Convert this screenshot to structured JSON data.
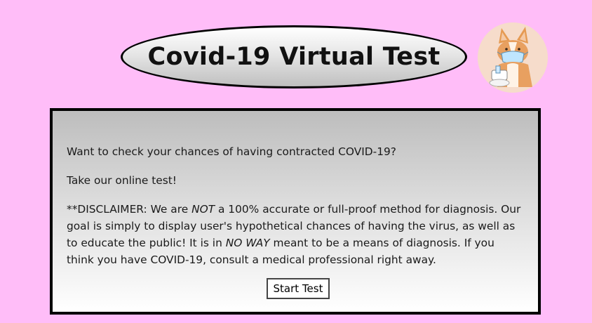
{
  "header": {
    "title": "Covid-19 Virtual Test",
    "avatar_icon": "corgi-with-face-mask-and-test-kit"
  },
  "card": {
    "question": "Want to check your chances of having contracted COVID-19?",
    "prompt": "Take our online test!",
    "disclaimer": {
      "prefix": "**DISCLAIMER: We are ",
      "emphasis_1": "NOT",
      "middle": " a 100% accurate or full-proof method for diagnosis. Our goal is simply to display user's hypothetical chances of having the virus, as well as to educate the public! It is in ",
      "emphasis_2": "NO WAY",
      "suffix": " meant to be a means of diagnosis. If you think you have COVID-19, consult a medical professional right away."
    },
    "start_button_label": "Start Test"
  },
  "colors": {
    "page_background": "#ffbdf8",
    "border": "#000000",
    "card_gradient_top": "#bdbdbd",
    "card_gradient_bottom": "#ffffff"
  }
}
